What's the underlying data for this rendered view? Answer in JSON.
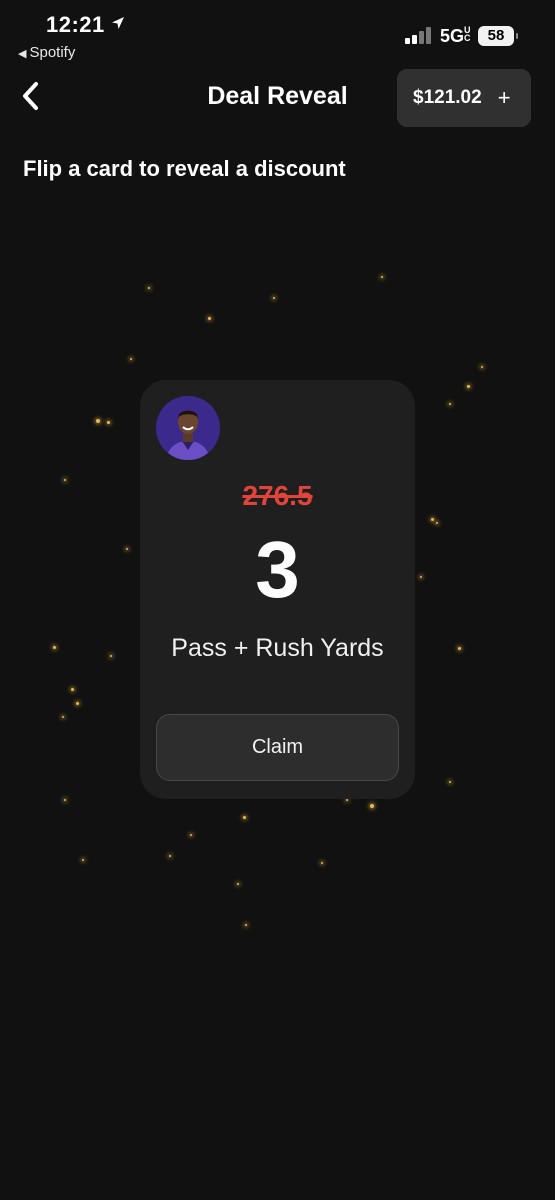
{
  "status_bar": {
    "time": "12:21",
    "back_app": "Spotify",
    "network": "5G",
    "network_mark": "UC",
    "battery": "58"
  },
  "header": {
    "title": "Deal Reveal",
    "balance": "$121.02",
    "add_symbol": "+"
  },
  "subtitle": "Flip a card to reveal a discount",
  "card": {
    "original_line": "276.5",
    "new_line": "3",
    "stat": "Pass + Rush Yards",
    "claim_label": "Claim"
  },
  "colors": {
    "background": "#111111",
    "card": "#1f1f1f",
    "strike_red": "#e0443b",
    "sparkle": "#e8b74d",
    "avatar_bg": "#3b2a8c"
  }
}
